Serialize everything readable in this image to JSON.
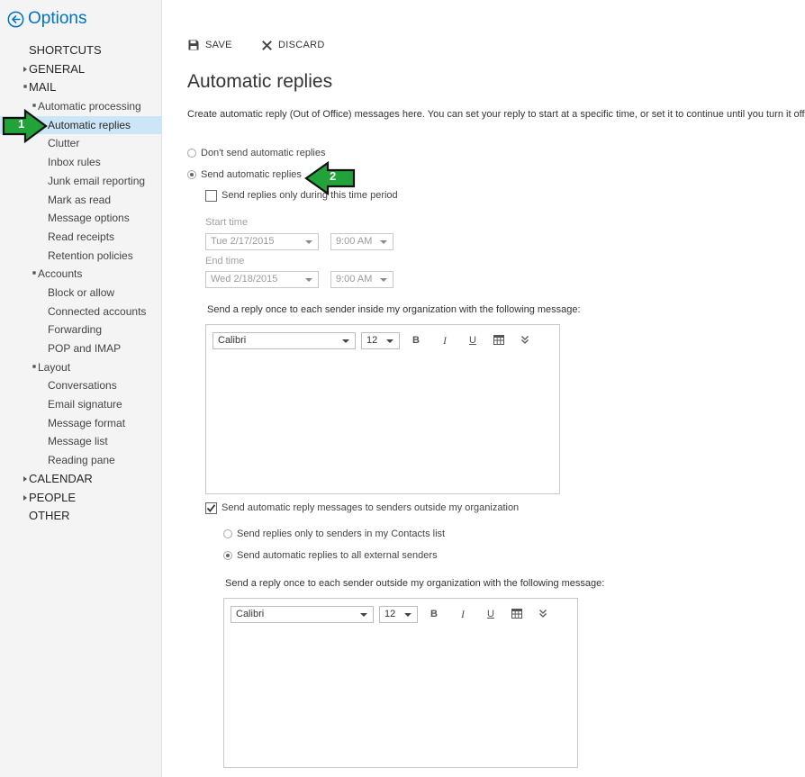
{
  "app": {
    "title": "Options"
  },
  "sidebar": {
    "shortcuts": "SHORTCUTS",
    "general": "GENERAL",
    "mail": "MAIL",
    "automatic_processing": "Automatic processing",
    "automatic_replies": "Automatic replies",
    "clutter": "Clutter",
    "inbox_rules": "Inbox rules",
    "junk_email_reporting": "Junk email reporting",
    "mark_as_read": "Mark as read",
    "message_options": "Message options",
    "read_receipts": "Read receipts",
    "retention_policies": "Retention policies",
    "accounts": "Accounts",
    "block_or_allow": "Block or allow",
    "connected_accounts": "Connected accounts",
    "forwarding": "Forwarding",
    "pop_and_imap": "POP and IMAP",
    "layout": "Layout",
    "conversations": "Conversations",
    "email_signature": "Email signature",
    "message_format": "Message format",
    "message_list": "Message list",
    "reading_pane": "Reading pane",
    "calendar": "CALENDAR",
    "people": "PEOPLE",
    "other": "OTHER"
  },
  "callouts": {
    "first": "1",
    "second": "2"
  },
  "toolbar": {
    "save_label": "SAVE",
    "discard_label": "DISCARD"
  },
  "page": {
    "title": "Automatic replies",
    "description": "Create automatic reply (Out of Office) messages here. You can set your reply to start at a specific time, or set it to continue until you turn it off."
  },
  "options": {
    "dont_send": "Don't send automatic replies",
    "send": "Send automatic replies",
    "time_period": "Send replies only during this time period",
    "start_time_label": "Start time",
    "start_date": "Tue 2/17/2015",
    "start_time": "9:00 AM",
    "end_time_label": "End time",
    "end_date": "Wed 2/18/2015",
    "end_time": "9:00 AM"
  },
  "inside": {
    "label": "Send a reply once to each sender inside my organization with the following message:",
    "font": "Calibri",
    "size": "12"
  },
  "outside": {
    "checkbox_label": "Send automatic reply messages to senders outside my organization",
    "contacts_only": "Send replies only to senders in my Contacts list",
    "all_external": "Send automatic replies to all external senders",
    "label": "Send a reply once to each sender outside my organization with the following message:",
    "font": "Calibri",
    "size": "12"
  },
  "format": {
    "bold": "B",
    "italic": "I",
    "underline": "U"
  },
  "colors": {
    "accent": "#0072c6",
    "selected_bg": "#cde6f7",
    "callout_green": "#22a33a",
    "sidebar_bg": "#f4f4f4"
  },
  "icons": {
    "back": "back-arrow-circle-icon",
    "save": "floppy-disk-icon",
    "discard": "x-icon",
    "table": "table-icon",
    "more": "double-chevron-down-icon"
  }
}
